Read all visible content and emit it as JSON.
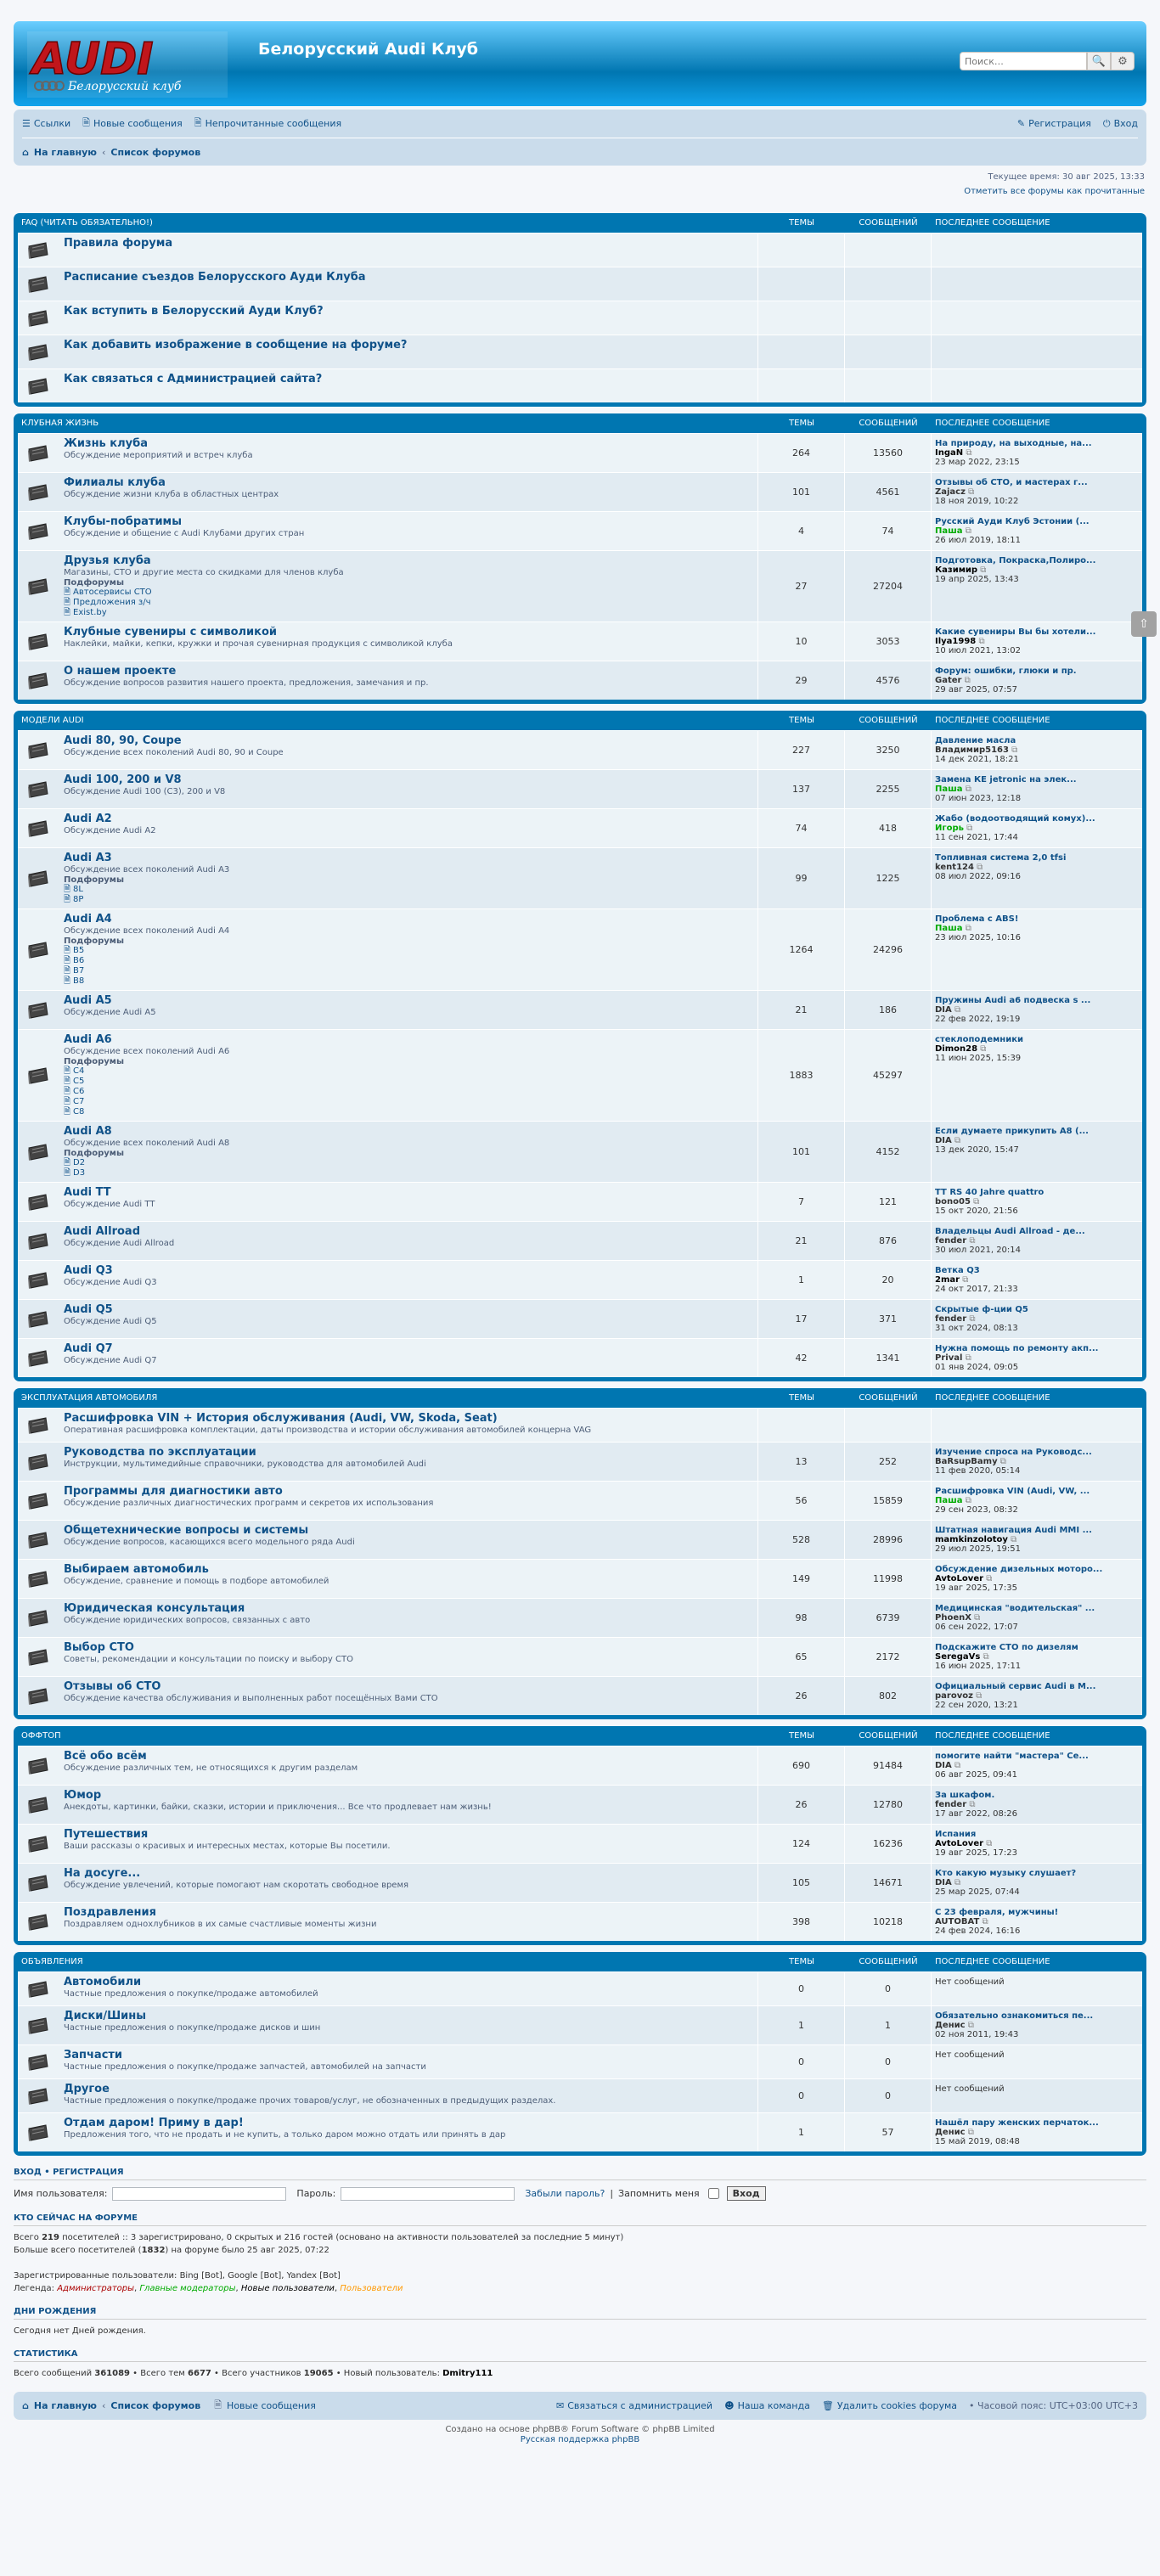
{
  "header": {
    "site_title": "Белорусский Audi Клуб",
    "logo_text": "AUDI",
    "logo_sub": "Белорусский клуб",
    "search_placeholder": "Поиск…"
  },
  "navbar": {
    "links": [
      {
        "label": "Ссылки",
        "icon": "menu-icon"
      },
      {
        "label": "Новые сообщения",
        "icon": "doc-icon"
      },
      {
        "label": "Непрочитанные сообщения",
        "icon": "doc-icon"
      }
    ],
    "register": "Регистрация",
    "login": "Вход",
    "crumbs": [
      "На главную",
      "Список форумов"
    ]
  },
  "current_time": "Текущее время: 30 авг 2025, 13:33",
  "mark_read": "Отметить все форумы как прочитанные",
  "columns": {
    "topics": "ТЕМЫ",
    "posts": "СООБЩЕНИЙ",
    "last": "ПОСЛЕДНЕЕ СООБЩЕНИЕ"
  },
  "categories": [
    {
      "title": "FAQ (ЧИТАТЬ ОБЯЗАТЕЛЬНО!)",
      "forums": [
        {
          "title": "Правила форума",
          "desc": "",
          "topics": "",
          "posts": "",
          "last_title": "",
          "last_user": "",
          "last_user_color": "",
          "last_date": ""
        },
        {
          "title": "Расписание съездов Белорусского Ауди Клуба",
          "desc": "",
          "topics": "",
          "posts": "",
          "last_title": "",
          "last_user": "",
          "last_user_color": "",
          "last_date": ""
        },
        {
          "title": "Как вступить в Белорусский Ауди Клуб?",
          "desc": "",
          "topics": "",
          "posts": "",
          "last_title": "",
          "last_user": "",
          "last_user_color": "",
          "last_date": ""
        },
        {
          "title": "Как добавить изображение в сообщение на форуме?",
          "desc": "",
          "topics": "",
          "posts": "",
          "last_title": "",
          "last_user": "",
          "last_user_color": "",
          "last_date": ""
        },
        {
          "title": "Как связаться с Администрацией сайта?",
          "desc": "",
          "topics": "",
          "posts": "",
          "last_title": "",
          "last_user": "",
          "last_user_color": "",
          "last_date": ""
        }
      ]
    },
    {
      "title": "КЛУБНАЯ ЖИЗНЬ",
      "forums": [
        {
          "title": "Жизнь клуба",
          "desc": "Обсуждение мероприятий и встреч клуба",
          "topics": "264",
          "posts": "13560",
          "last_title": "На природу, на выходные, на...",
          "last_user": "IngaN",
          "last_user_color": "#000000",
          "last_date": "23 мар 2022, 23:15"
        },
        {
          "title": "Филиалы клуба",
          "desc": "Обсуждение жизни клуба в областных центрах",
          "topics": "101",
          "posts": "4561",
          "last_title": "Отзывы об СТО, и мастерах г...",
          "last_user": "Zajacz",
          "last_user_color": "#333333",
          "last_date": "18 ноя 2019, 10:22"
        },
        {
          "title": "Клубы-побратимы",
          "desc": "Обсуждение и общение с Audi Клубами других стран",
          "topics": "4",
          "posts": "74",
          "last_title": "Русский Ауди Клуб Эстонии (...",
          "last_user": "Паша",
          "last_user_color": "#00AA00",
          "last_date": "26 июл 2019, 18:11"
        },
        {
          "title": "Друзья клуба",
          "desc": "Магазины, СТО и другие места со скидками для членов клуба",
          "sub_label": "Подфорумы",
          "subs": [
            "Автосервисы СТО",
            "Предложения з/ч",
            "Exist.by"
          ],
          "topics": "27",
          "posts": "27204",
          "last_title": "Подготовка, Покраска,Полиро...",
          "last_user": "Казимир",
          "last_user_color": "#000000",
          "last_date": "19 апр 2025, 13:43"
        },
        {
          "title": "Клубные сувениры с символикой",
          "desc": "Наклейки, майки, кепки, кружки и прочая сувенирная продукция с символикой клуба",
          "topics": "10",
          "posts": "3053",
          "last_title": "Какие сувениры Вы бы хотели...",
          "last_user": "Ilya1998",
          "last_user_color": "#000000",
          "last_date": "10 июл 2021, 13:02"
        },
        {
          "title": "О нашем проекте",
          "desc": "Обсуждение вопросов развития нашего проекта, предложения, замечания и пр.",
          "topics": "29",
          "posts": "4576",
          "last_title": "Форум: ошибки, глюки и пр.",
          "last_user": "Gater",
          "last_user_color": "#333333",
          "last_date": "29 авг 2025, 07:57"
        }
      ]
    },
    {
      "title": "МОДЕЛИ AUDI",
      "forums": [
        {
          "title": "Audi 80, 90, Coupe",
          "desc": "Обсуждение всех поколений Audi 80, 90 и Coupe",
          "topics": "227",
          "posts": "3250",
          "last_title": "Давление масла",
          "last_user": "Владимир5163",
          "last_user_color": "#333333",
          "last_date": "14 дек 2021, 18:21"
        },
        {
          "title": "Audi 100, 200 и V8",
          "desc": "Обсуждение Audi 100 (C3), 200 и V8",
          "topics": "137",
          "posts": "2255",
          "last_title": "Замена КЕ jetronic на элек...",
          "last_user": "Паша",
          "last_user_color": "#00AA00",
          "last_date": "07 июн 2023, 12:18"
        },
        {
          "title": "Audi A2",
          "desc": "Обсуждение Audi A2",
          "topics": "74",
          "posts": "418",
          "last_title": "Жабо (водоотводящий комух)...",
          "last_user": "Игорь",
          "last_user_color": "#00AA00",
          "last_date": "11 сен 2021, 17:44"
        },
        {
          "title": "Audi A3",
          "desc": "Обсуждение всех поколений Audi A3",
          "sub_label": "Подфорумы",
          "subs": [
            "8L",
            "8P"
          ],
          "topics": "99",
          "posts": "1225",
          "last_title": "Топливная система 2,0 tfsi",
          "last_user": "kent124",
          "last_user_color": "#333333",
          "last_date": "08 июл 2022, 09:16"
        },
        {
          "title": "Audi A4",
          "desc": "Обсуждение всех поколений Audi A4",
          "sub_label": "Подфорумы",
          "subs": [
            "B5",
            "B6",
            "B7",
            "B8"
          ],
          "topics": "1264",
          "posts": "24296",
          "last_title": "Проблема с ABS!",
          "last_user": "Паша",
          "last_user_color": "#00AA00",
          "last_date": "23 июл 2025, 10:16"
        },
        {
          "title": "Audi A5",
          "desc": "Обсуждение Audi A5",
          "topics": "21",
          "posts": "186",
          "last_title": "Пружины Audi а6 подвеска s ...",
          "last_user": "DIA",
          "last_user_color": "#333333",
          "last_date": "22 фев 2022, 19:19"
        },
        {
          "title": "Audi A6",
          "desc": "Обсуждение всех поколений Audi A6",
          "sub_label": "Подфорумы",
          "subs": [
            "C4",
            "C5",
            "C6",
            "C7",
            "C8"
          ],
          "topics": "1883",
          "posts": "45297",
          "last_title": "стеклоподемники",
          "last_user": "Dimon28",
          "last_user_color": "#000000",
          "last_date": "11 июн 2025, 15:39"
        },
        {
          "title": "Audi A8",
          "desc": "Обсуждение всех поколений Audi A8",
          "sub_label": "Подфорумы",
          "subs": [
            "D2",
            "D3"
          ],
          "topics": "101",
          "posts": "4152",
          "last_title": "Если думаете прикупить A8 (...",
          "last_user": "DIA",
          "last_user_color": "#333333",
          "last_date": "13 дек 2020, 15:47"
        },
        {
          "title": "Audi TT",
          "desc": "Обсуждение Audi TT",
          "topics": "7",
          "posts": "121",
          "last_title": "TT RS 40 Jahre quattro",
          "last_user": "bono05",
          "last_user_color": "#333333",
          "last_date": "15 окт 2020, 21:56"
        },
        {
          "title": "Audi Allroad",
          "desc": "Обсуждение Audi Allroad",
          "topics": "21",
          "posts": "876",
          "last_title": "Владельцы Audi Allroad - де...",
          "last_user": "fender",
          "last_user_color": "#333333",
          "last_date": "30 июл 2021, 20:14"
        },
        {
          "title": "Audi Q3",
          "desc": "Обсуждение Audi Q3",
          "topics": "1",
          "posts": "20",
          "last_title": "Ветка Q3",
          "last_user": "2mar",
          "last_user_color": "#000000",
          "last_date": "24 окт 2017, 21:33"
        },
        {
          "title": "Audi Q5",
          "desc": "Обсуждение Audi Q5",
          "topics": "17",
          "posts": "371",
          "last_title": "Скрытые ф-ции Q5",
          "last_user": "fender",
          "last_user_color": "#333333",
          "last_date": "31 окт 2024, 08:13"
        },
        {
          "title": "Audi Q7",
          "desc": "Обсуждение Audi Q7",
          "topics": "42",
          "posts": "1341",
          "last_title": "Нужна помощь по ремонту акп...",
          "last_user": "Prival",
          "last_user_color": "#333333",
          "last_date": "01 янв 2024, 09:05"
        }
      ]
    },
    {
      "title": "ЭКСПЛУАТАЦИЯ АВТОМОБИЛЯ",
      "forums": [
        {
          "title": "Расшифровка VIN + История обслуживания (Audi, VW, Skoda, Seat)",
          "desc": "Оперативная расшифровка комплектации, даты производства и истории обслуживания автомобилей концерна VAG",
          "topics": "",
          "posts": "",
          "last_title": "",
          "last_user": "",
          "last_user_color": "",
          "last_date": ""
        },
        {
          "title": "Руководства по эксплуатации",
          "desc": "Инструкции, мультимедийные справочники, руководства для автомобилей Audi",
          "topics": "13",
          "posts": "252",
          "last_title": "Изучение спроса на Руководс...",
          "last_user": "BaRsupBamy",
          "last_user_color": "#333333",
          "last_date": "11 фев 2020, 05:14"
        },
        {
          "title": "Программы для диагностики авто",
          "desc": "Обсуждение различных диагностических программ и секретов их использования",
          "topics": "56",
          "posts": "15859",
          "last_title": "Расшифровка VIN (Audi, VW, ...",
          "last_user": "Паша",
          "last_user_color": "#00AA00",
          "last_date": "29 сен 2023, 08:32"
        },
        {
          "title": "Общетехнические вопросы и системы",
          "desc": "Обсуждение вопросов, касающихся всего модельного ряда Audi",
          "topics": "528",
          "posts": "28996",
          "last_title": "Штатная навигация Audi MMI ...",
          "last_user": "mamkinzolotoy",
          "last_user_color": "#000000",
          "last_date": "29 июл 2025, 19:51"
        },
        {
          "title": "Выбираем автомобиль",
          "desc": "Обсуждение, сравнение и помощь в подборе автомобилей",
          "topics": "149",
          "posts": "11998",
          "last_title": "Обсуждение дизельных моторо...",
          "last_user": "AvtoLover",
          "last_user_color": "#000000",
          "last_date": "19 авг 2025, 17:35"
        },
        {
          "title": "Юридическая консультация",
          "desc": "Обсуждение юридических вопросов, связанных с авто",
          "topics": "98",
          "posts": "6739",
          "last_title": "Медицинская \"водительская\" ...",
          "last_user": "PhoenX",
          "last_user_color": "#333333",
          "last_date": "06 сен 2022, 17:07"
        },
        {
          "title": "Выбор СТО",
          "desc": "Советы, рекомендации и консультации по поиску и выбору СТО",
          "topics": "65",
          "posts": "2172",
          "last_title": "Подскажите СТО по дизелям",
          "last_user": "SeregaVs",
          "last_user_color": "#000000",
          "last_date": "16 июн 2025, 17:11"
        },
        {
          "title": "Отзывы об СТО",
          "desc": "Обсуждение качества обслуживания и выполненных работ посещённых Вами СТО",
          "topics": "26",
          "posts": "802",
          "last_title": "Официальный сервис Audi в М...",
          "last_user": "parovoz",
          "last_user_color": "#333333",
          "last_date": "22 сен 2020, 13:21"
        }
      ]
    },
    {
      "title": "ОФФТОП",
      "forums": [
        {
          "title": "Всё обо всём",
          "desc": "Обсуждение различных тем, не относящихся к другим разделам",
          "topics": "690",
          "posts": "91484",
          "last_title": "помогите найти \"мастера\" Се...",
          "last_user": "DIA",
          "last_user_color": "#333333",
          "last_date": "06 авг 2025, 09:41"
        },
        {
          "title": "Юмор",
          "desc": "Анекдоты, картинки, байки, сказки, истории и приключения... Все что продлевает нам жизнь!",
          "topics": "26",
          "posts": "12780",
          "last_title": "За шкафом.",
          "last_user": "fender",
          "last_user_color": "#333333",
          "last_date": "17 авг 2022, 08:26"
        },
        {
          "title": "Путешествия",
          "desc": "Ваши рассказы о красивых и интересных местах, которые Вы посетили.",
          "topics": "124",
          "posts": "16236",
          "last_title": "Испания",
          "last_user": "AvtoLover",
          "last_user_color": "#000000",
          "last_date": "19 авг 2025, 17:23"
        },
        {
          "title": "На досуге...",
          "desc": "Обсуждение увлечений, которые помогают нам скоротать свободное время",
          "topics": "105",
          "posts": "14671",
          "last_title": "Кто какую музыку слушает?",
          "last_user": "DIA",
          "last_user_color": "#333333",
          "last_date": "25 мар 2025, 07:44"
        },
        {
          "title": "Поздравления",
          "desc": "Поздравляем однохлубников в их самые счастливые моменты жизни",
          "topics": "398",
          "posts": "10218",
          "last_title": "С 23 февраля, мужчины!",
          "last_user": "AUTOBAT",
          "last_user_color": "#333333",
          "last_date": "24 фев 2024, 16:16"
        }
      ]
    },
    {
      "title": "ОБЪЯВЛЕНИЯ",
      "forums": [
        {
          "title": "Автомобили",
          "desc": "Частные предложения о покупке/продаже автомобилей",
          "topics": "0",
          "posts": "0",
          "last_title": "",
          "last_user": "",
          "last_user_color": "",
          "last_date": "",
          "nomsg": "Нет сообщений"
        },
        {
          "title": "Диски/Шины",
          "desc": "Частные предложения о покупке/продаже дисков и шин",
          "topics": "1",
          "posts": "1",
          "last_title": "Обязательно ознакомиться пе...",
          "last_user": "Денис",
          "last_user_color": "#333333",
          "last_date": "02 ноя 2011, 19:43"
        },
        {
          "title": "Запчасти",
          "desc": "Частные предложения о покупке/продаже запчастей, автомобилей на запчасти",
          "topics": "0",
          "posts": "0",
          "last_title": "",
          "last_user": "",
          "last_user_color": "",
          "last_date": "",
          "nomsg": "Нет сообщений"
        },
        {
          "title": "Другое",
          "desc": "Частные предложения о покупке/продаже прочих товаров/услуг, не обозначенных в предыдущих разделах.",
          "topics": "0",
          "posts": "0",
          "last_title": "",
          "last_user": "",
          "last_user_color": "",
          "last_date": "",
          "nomsg": "Нет сообщений"
        },
        {
          "title": "Отдам даром! Приму в дар!",
          "desc": "Предложения того, что не продать и не купить, а только даром можно отдать или принять в дар",
          "topics": "1",
          "posts": "57",
          "last_title": "Нашёл пару женских перчаток...",
          "last_user": "Денис",
          "last_user_color": "#333333",
          "last_date": "15 май 2019, 08:48"
        }
      ]
    }
  ],
  "login_block": {
    "heading": "ВХОД • РЕГИСТРАЦИЯ",
    "user_label": "Имя пользователя:",
    "pass_label": "Пароль:",
    "forgot": "Забыли пароль?",
    "remember": "Запомнить меня",
    "button": "Вход"
  },
  "online": {
    "heading": "КТО СЕЙЧАС НА ФОРУМЕ",
    "line1_a": "Всего ",
    "line1_b": "219",
    "line1_c": " посетителей :: 3 зарегистрировано, 0 скрытых и 216 гостей (основано на активности пользователей за последние 5 минут)",
    "line2_a": "Больше всего посетителей (",
    "line2_b": "1832",
    "line2_c": ") на форуме было 25 авг 2025, 07:22",
    "registered": "Зарегистрированные пользователи: Bing [Bot], Google [Bot], Yandex [Bot]",
    "legend_label": "Легенда: ",
    "legend_admins": "Администраторы",
    "legend_gmods": "Главные модераторы",
    "legend_new": "Новые пользователи",
    "legend_users": "Пользователи"
  },
  "birthdays": {
    "heading": "ДНИ РОЖДЕНИЯ",
    "text": "Сегодня нет Дней рождения."
  },
  "stats": {
    "heading": "СТАТИСТИКА",
    "a": "Всего сообщений ",
    "posts": "361089",
    "b": " • Всего тем ",
    "topics": "6677",
    "c": " • Всего участников ",
    "members": "19065",
    "d": " • Новый пользователь: ",
    "newest": "Dmitry111"
  },
  "footer": {
    "crumbs": [
      "На главную",
      "Список форумов"
    ],
    "new_posts": "Новые сообщения",
    "contact": "Связаться с администрацией",
    "team": "Наша команда",
    "delete_cookies": "Удалить cookies форума",
    "timezone": "Часовой пояс: UTC+03:00",
    "tz_code": "UTC+3",
    "powered": "Создано на основе phpBB® Forum Software © phpBB Limited",
    "support": "Русская поддержка phpBB"
  },
  "colors": {
    "header_blue": "#0076b1",
    "link": "#105289",
    "row_a": "#ecf3f7",
    "row_b": "#e1ebf2",
    "nav": "#cadceb"
  }
}
